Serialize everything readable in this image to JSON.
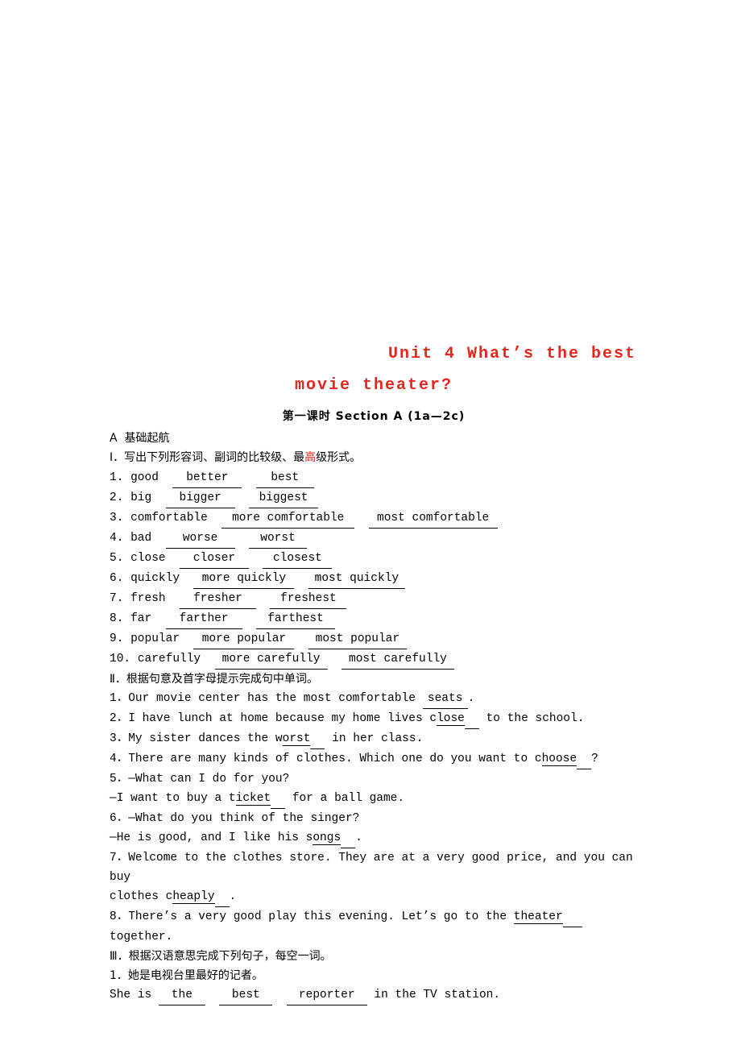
{
  "document": {
    "title_line1": "Unit  4  What’s the best",
    "title_line2": "movie  theater?",
    "subtitle": "第一课时  Section A (1a—2c)",
    "section_a_label": "A  基础起航",
    "part1": {
      "heading_prefix": "Ⅰ．写出下列形容词、副词的比较级、最",
      "heading_dot": "高",
      "heading_suffix": "级形式。",
      "items": [
        {
          "num": "1.",
          "word": "good",
          "comparative": "better",
          "superlative": "best"
        },
        {
          "num": "2.",
          "word": "big",
          "comparative": "bigger",
          "superlative": "biggest"
        },
        {
          "num": "3.",
          "word": "comfortable",
          "comparative": "more comfortable",
          "superlative": "most comfortable"
        },
        {
          "num": "4.",
          "word": "bad",
          "comparative": "worse",
          "superlative": "worst"
        },
        {
          "num": "5.",
          "word": "close",
          "comparative": "closer",
          "superlative": "closest"
        },
        {
          "num": "6.",
          "word": "quickly",
          "comparative": "more quickly",
          "superlative": "most quickly"
        },
        {
          "num": "7.",
          "word": "fresh",
          "comparative": "fresher",
          "superlative": "freshest"
        },
        {
          "num": "8.",
          "word": "far",
          "comparative": "farther",
          "superlative": "farthest"
        },
        {
          "num": "9.",
          "word": "popular",
          "comparative": "more popular",
          "superlative": "most popular"
        },
        {
          "num": "10.",
          "word": "carefully",
          "comparative": "more carefully",
          "superlative": "most carefully"
        }
      ]
    },
    "part2": {
      "heading": "Ⅱ．根据句意及首字母提示完成句中单词。",
      "q1_pre": "1．Our movie center has the most comfortable ",
      "q1_ans": "seats",
      "q1_post": ".",
      "q2_pre": "2．I have lunch at home because my home lives c",
      "q2_ans": "lose",
      "q2_post": " to the school.",
      "q3_pre": "3．My sister dances the w",
      "q3_ans": "orst",
      "q3_post": " in her class.",
      "q4_pre": "4．There are many kinds of clothes. Which one do you want to c",
      "q4_ans": "hoose",
      "q4_post": "?",
      "q5_line1": "5．—What can I do for you?",
      "q5_line2_pre": "—I want to buy a t",
      "q5_ans": "icket",
      "q5_line2_post": " for a ball game.",
      "q6_line1": "6．—What do you think of the singer?",
      "q6_line2_pre": "—He is good, and I like his s",
      "q6_ans": "ongs",
      "q6_line2_post": ".",
      "q7_line1": "7．Welcome to the clothes store. They are at a very good price, and you can buy",
      "q7_line2_pre": "clothes c",
      "q7_ans": "heaply",
      "q7_line2_post": ".",
      "q8_pre": "8．There’s a very good play this evening. Let’s go to the ",
      "q8_ans": "theater",
      "q8_post": "  together."
    },
    "part3": {
      "heading": "Ⅲ．根据汉语意思完成下列句子，每空一词。",
      "q1_cn": "1．她是电视台里最好的记者。",
      "q1_pre": "She is ",
      "q1_a1": "the",
      "q1_a2": "best",
      "q1_a3": "reporter",
      "q1_post": " in the TV station."
    }
  }
}
